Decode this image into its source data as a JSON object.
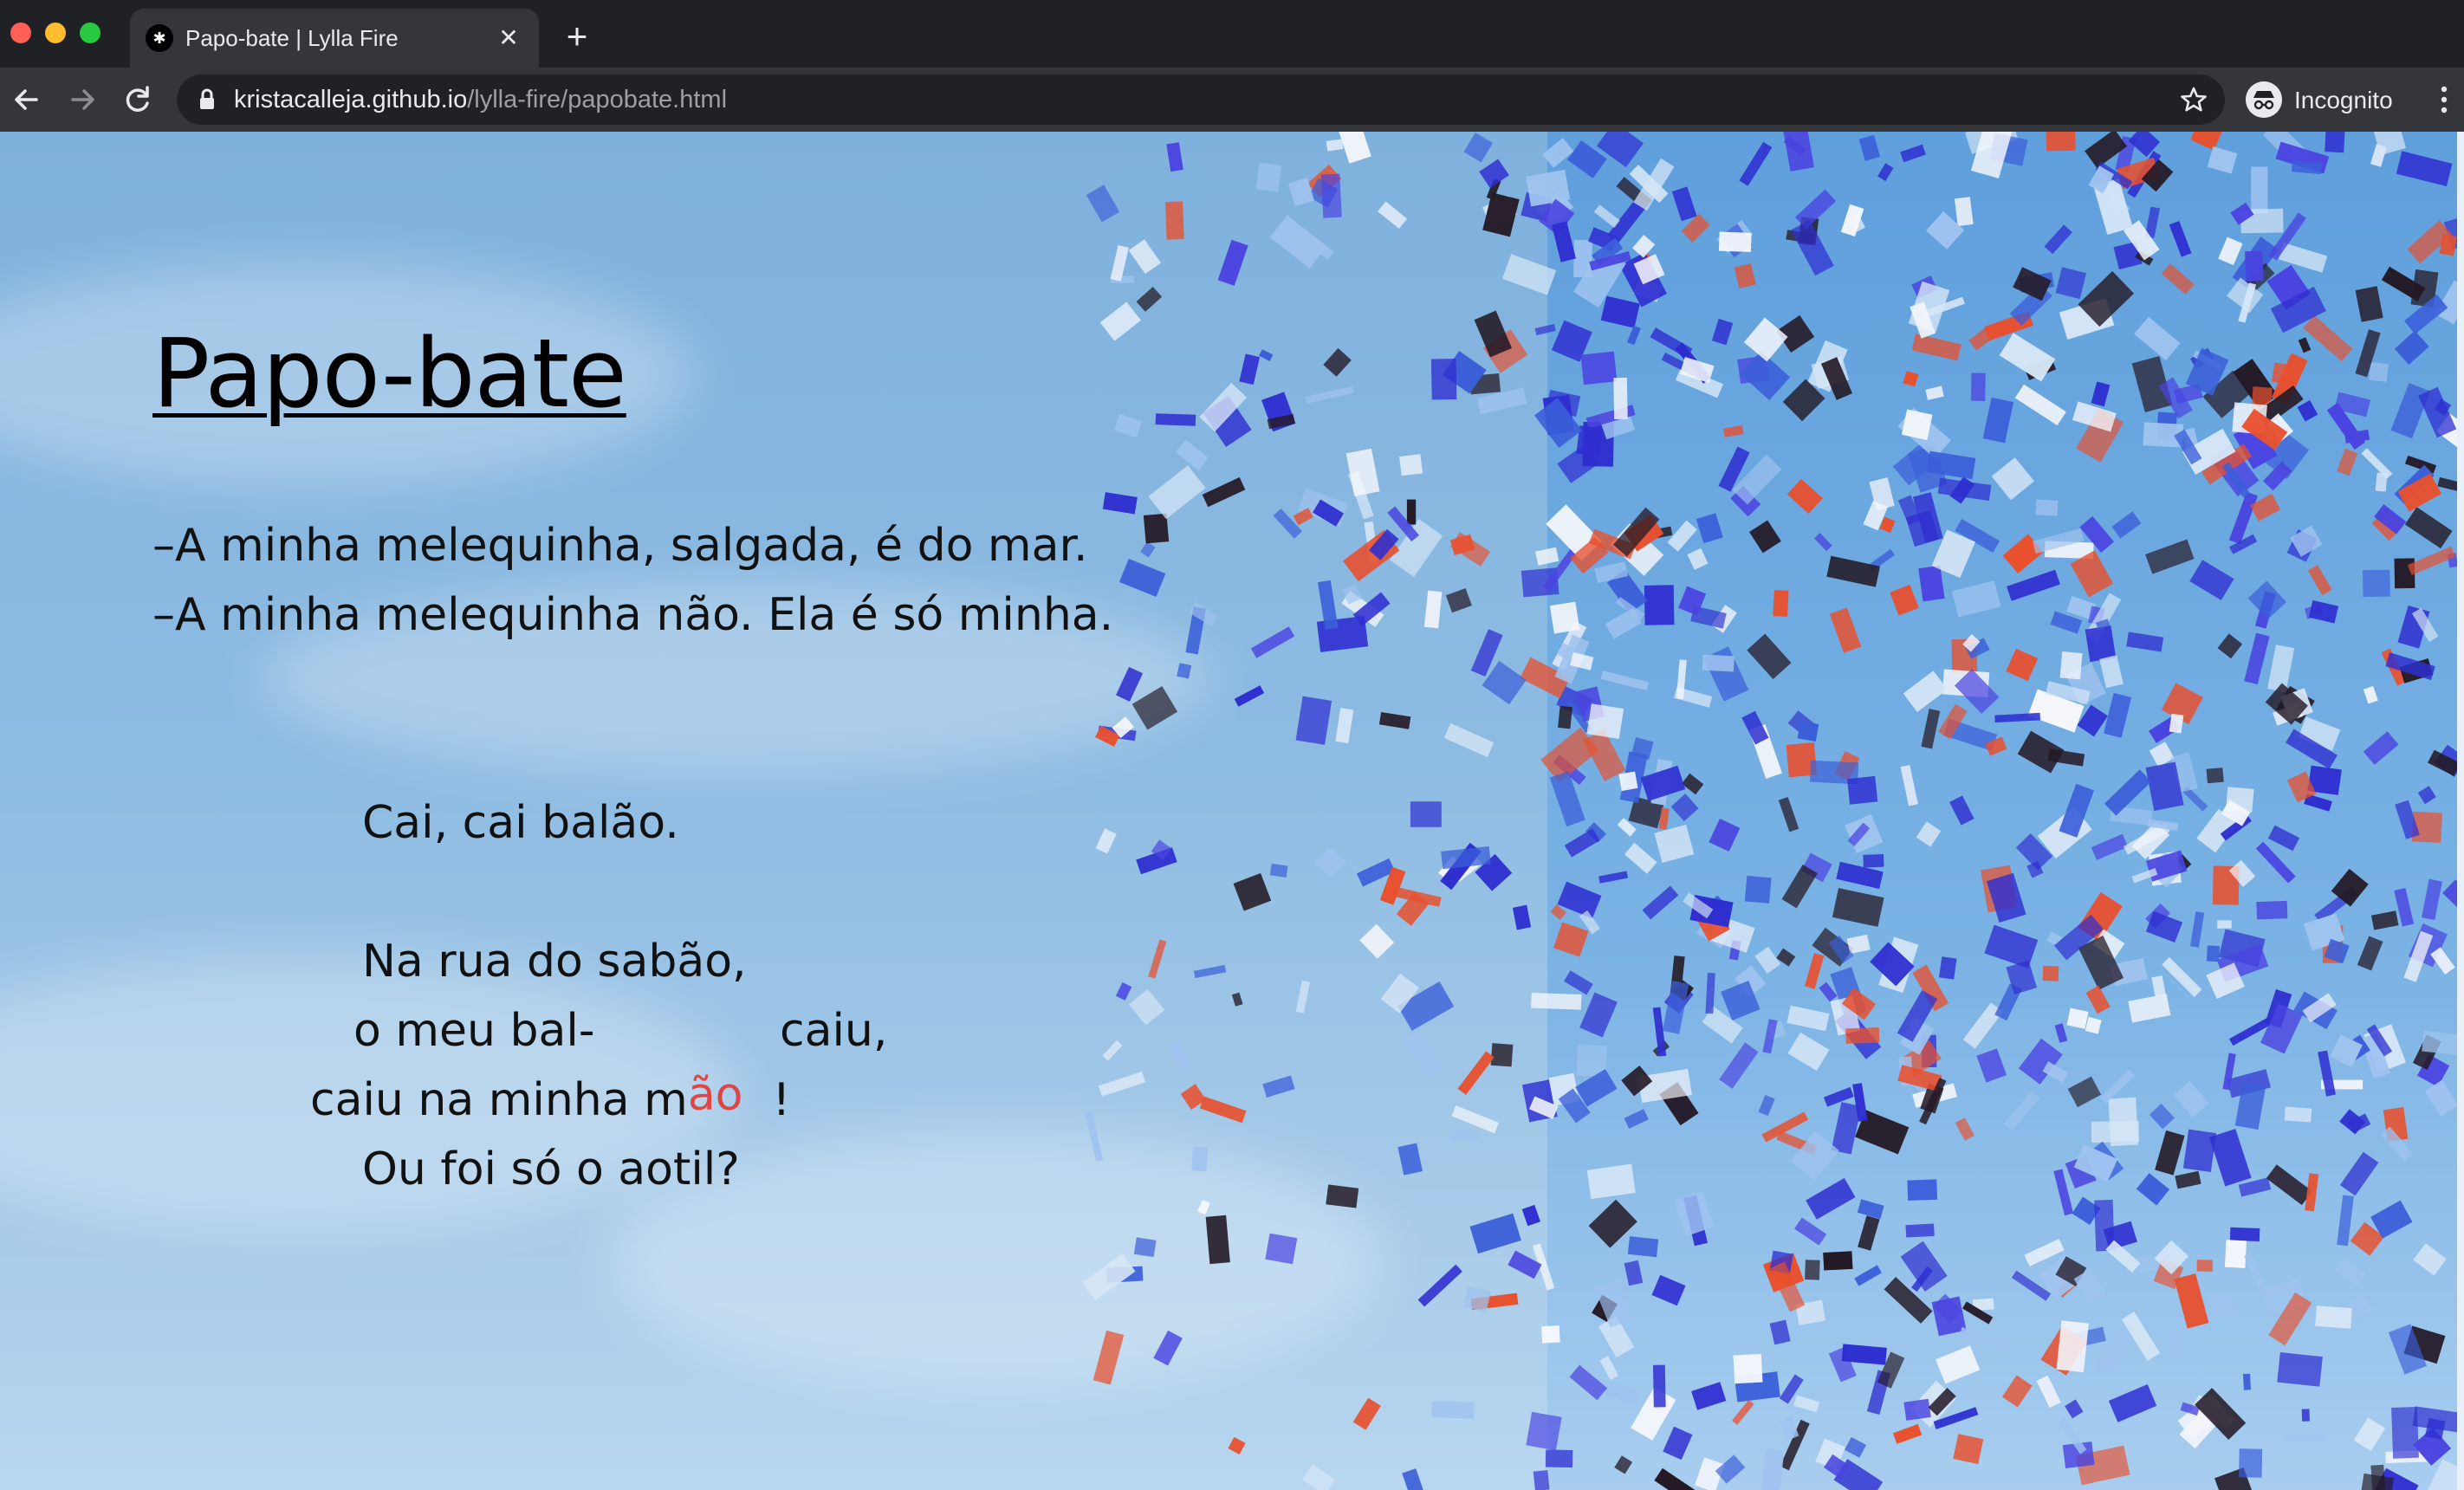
{
  "browser": {
    "tab_title": "Papo-bate | Lylla Fire",
    "tab_close": "✕",
    "new_tab": "+",
    "url_host": "kristacalleja.github.io",
    "url_path": "/lylla-fire/papobate.html",
    "incognito_label": "Incognito"
  },
  "page": {
    "title": "Papo-bate",
    "dialogue": [
      "–A minha melequinha, salgada, é do mar.",
      "–A minha melequinha não. Ela é só minha."
    ],
    "poem": {
      "line1": "Cai, cai balão.",
      "line2": "Na rua do sabão,",
      "line3a": "o meu bal-",
      "line3b": "caiu,",
      "line4a": "caiu na minha m",
      "line4_red": "ão",
      "line4b": "!",
      "line5": "Ou foi só o aotil?"
    }
  },
  "colors": {
    "chrome_dark": "#202124",
    "chrome_toolbar": "#35363a",
    "sky": "#8dbbe2",
    "confetti_orange": "#e8502e",
    "confetti_blue": "#2f2fd0",
    "highlight_red": "#e04545"
  }
}
